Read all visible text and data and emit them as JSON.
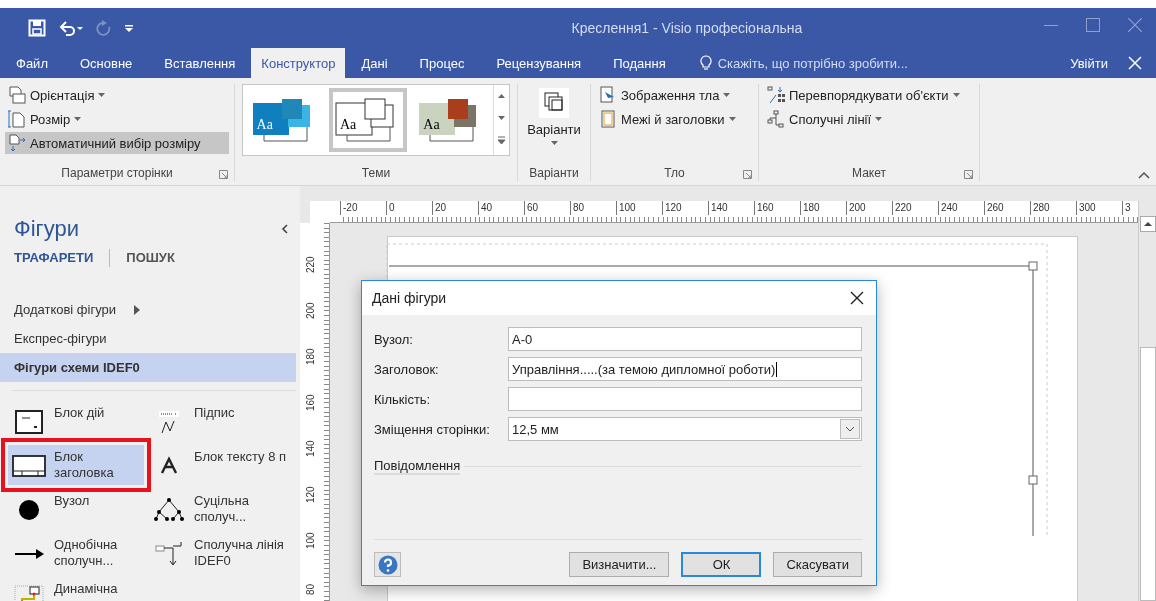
{
  "window": {
    "title": "Креслення1 - Visio професіональна"
  },
  "quick_access": [
    {
      "kind": "save",
      "disabled": false
    },
    {
      "kind": "undo",
      "disabled": false
    },
    {
      "kind": "redo",
      "disabled": true
    },
    {
      "kind": "customize",
      "disabled": false
    }
  ],
  "tabs": [
    {
      "label": "Файл",
      "selected": false
    },
    {
      "label": "Основне",
      "selected": false
    },
    {
      "label": "Вставлення",
      "selected": false
    },
    {
      "label": "Конструктор",
      "selected": true
    },
    {
      "label": "Дані",
      "selected": false
    },
    {
      "label": "Процес",
      "selected": false
    },
    {
      "label": "Рецензування",
      "selected": false
    },
    {
      "label": "Подання",
      "selected": false
    }
  ],
  "tell_me": {
    "placeholder": "Скажіть, що потрібно зробити..."
  },
  "sign_in": "Увійти",
  "ribbon": {
    "groups": [
      {
        "kind": "list",
        "label": "Параметри сторінки",
        "launcher": true,
        "items": [
          {
            "label": "Орієнтація",
            "dropdown": true,
            "on": false
          },
          {
            "label": "Розмір",
            "dropdown": true,
            "on": false
          },
          {
            "label": "Автоматичний вибір розміру",
            "dropdown": false,
            "on": true
          }
        ]
      },
      {
        "kind": "gallery",
        "label": "Теми",
        "launcher": false,
        "themes": [
          {
            "caption": "Aa",
            "selected": false
          },
          {
            "caption": "Aa",
            "selected": true
          },
          {
            "caption": "Aa",
            "selected": false
          }
        ]
      },
      {
        "kind": "big",
        "label": "Варіанти",
        "launcher": false,
        "button": "Варіанти"
      },
      {
        "kind": "list",
        "label": "Тло",
        "launcher": true,
        "items": [
          {
            "label": "Зображення тла",
            "dropdown": true,
            "on": false
          },
          {
            "label": "Межі й заголовки",
            "dropdown": true,
            "on": false
          }
        ]
      },
      {
        "kind": "list",
        "label": "Макет",
        "launcher": true,
        "items": [
          {
            "label": "Перевпорядкувати об'єкти",
            "dropdown": true,
            "on": false
          },
          {
            "label": "Сполучні лінії",
            "dropdown": true,
            "on": false
          }
        ]
      }
    ]
  },
  "shapes_panel": {
    "title": "Фігури",
    "tabs": [
      {
        "label": "ТРАФАРЕТИ",
        "selected": true
      },
      {
        "label": "ПОШУК",
        "selected": false
      }
    ],
    "stencils": [
      {
        "label": "Додаткові фігури",
        "submenu": true,
        "selected": false
      },
      {
        "label": "Експрес-фігури",
        "submenu": false,
        "selected": false
      },
      {
        "label": "Фігури схеми IDEF0",
        "submenu": false,
        "selected": true
      }
    ],
    "shapes": [
      {
        "label": "Блок дій",
        "selected": false,
        "highlighted": false
      },
      {
        "label": "Підпис",
        "selected": false,
        "highlighted": false
      },
      {
        "label": "Блок заголовка",
        "selected": true,
        "highlighted": true
      },
      {
        "label": "Блок тексту 8 п",
        "selected": false,
        "highlighted": false
      },
      {
        "label": "Вузол",
        "selected": false,
        "highlighted": false
      },
      {
        "label": "Суцільна сполуч...",
        "selected": false,
        "highlighted": false
      },
      {
        "label": "Однобічна сполучн...",
        "selected": false,
        "highlighted": false
      },
      {
        "label": "Сполучна лінія IDEF0",
        "selected": false,
        "highlighted": false
      },
      {
        "label": "Динамічна",
        "selected": false,
        "highlighted": false
      }
    ]
  },
  "rulers": {
    "horizontal": [
      "-20",
      "0",
      "20",
      "40",
      "60",
      "80",
      "100",
      "120",
      "140",
      "160",
      "180",
      "200",
      "220",
      "240",
      "260",
      "280",
      "300",
      "3"
    ],
    "vertical": [
      "220",
      "200",
      "180",
      "160",
      "140",
      "120",
      "100",
      "80"
    ]
  },
  "dialog": {
    "title": "Дані фігури",
    "fields": [
      {
        "kind": "text",
        "label": "Вузол:",
        "value": "А-0",
        "focused": false
      },
      {
        "kind": "text",
        "label": "Заголовок:",
        "value": "Управління.....(за темою дипломної роботи)",
        "focused": true
      },
      {
        "kind": "text",
        "label": "Кількість:",
        "focused": false
      },
      {
        "kind": "dropdown",
        "label": "Зміщення сторінки:",
        "value": "12,5 мм",
        "focused": false
      }
    ],
    "section": "Повідомлення",
    "buttons": [
      {
        "label": "Визначити...",
        "default": false
      },
      {
        "label": "ОК",
        "default": true
      },
      {
        "label": "Скасувати",
        "default": false
      }
    ]
  }
}
